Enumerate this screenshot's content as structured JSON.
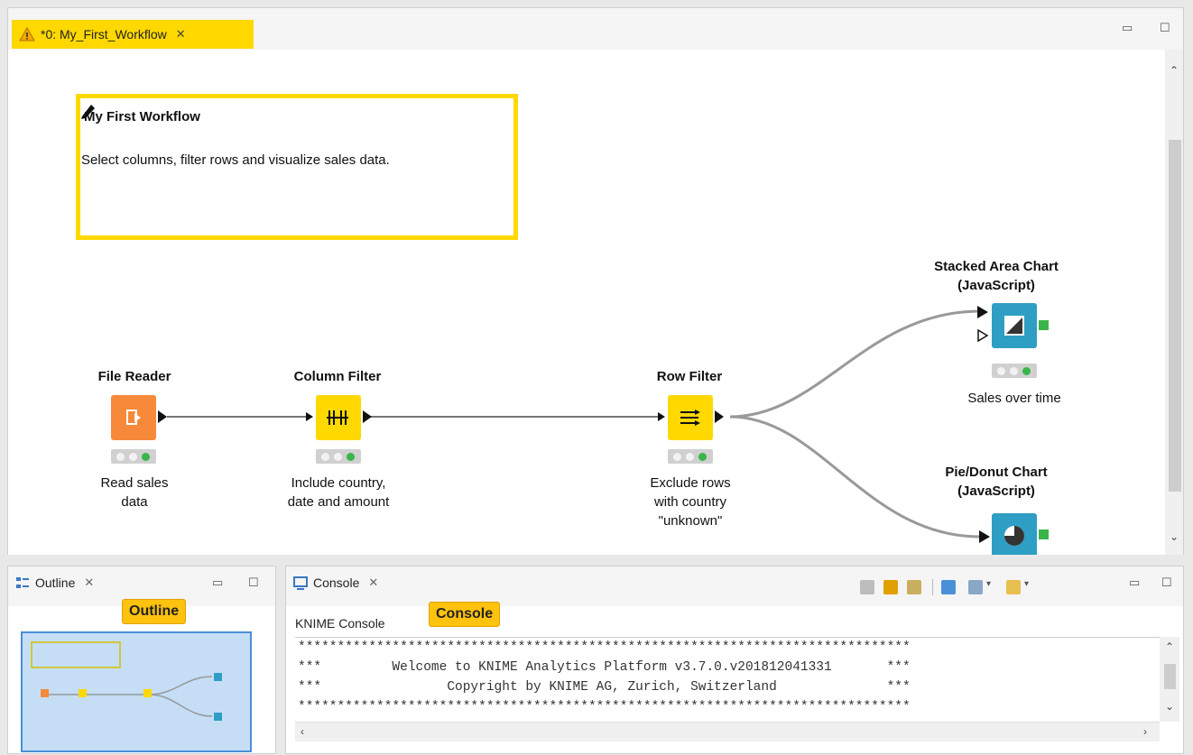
{
  "editor": {
    "tab_label": "*0: My_First_Workflow",
    "annotation": {
      "title": "My First Workflow",
      "text": "Select columns, filter rows and visualize sales data."
    }
  },
  "nodes": {
    "file_reader": {
      "name": "File Reader",
      "description": "Read sales\ndata",
      "color": "#f7893a"
    },
    "column_filter": {
      "name": "Column Filter",
      "description": "Include country,\ndate and amount",
      "color": "#ffd800"
    },
    "row_filter": {
      "name": "Row Filter",
      "description": "Exclude rows\nwith country\n\"unknown\"",
      "color": "#ffd800"
    },
    "stacked_area": {
      "name": "Stacked Area Chart\n(JavaScript)",
      "description": "Sales over time",
      "color": "#2f9ec4"
    },
    "pie_donut": {
      "name": "Pie/Donut Chart\n(JavaScript)",
      "description": "",
      "color": "#2f9ec4"
    }
  },
  "outline": {
    "tab_label": "Outline",
    "badge": "Outline"
  },
  "console": {
    "tab_label": "Console",
    "badge": "Console",
    "subtitle": "KNIME Console",
    "lines": [
      "******************************************************************************",
      "***         Welcome to KNIME Analytics Platform v3.7.0.v201812041331       ***",
      "***                Copyright by KNIME AG, Zurich, Switzerland              ***",
      "******************************************************************************"
    ]
  },
  "colors": {
    "accent_yellow": "#ffd800",
    "status_green": "#39b54a"
  }
}
